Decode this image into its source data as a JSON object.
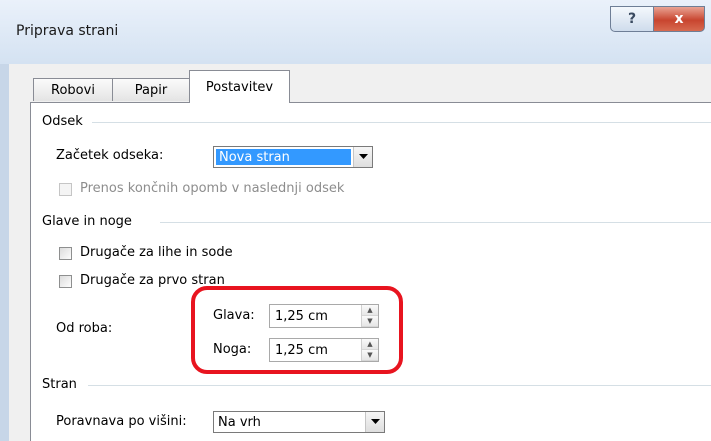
{
  "window": {
    "title": "Priprava strani",
    "help_symbol": "?",
    "close_symbol": "x"
  },
  "tabs": [
    {
      "label": "Robovi",
      "active": false
    },
    {
      "label": "Papir",
      "active": false
    },
    {
      "label": "Postavitev",
      "active": true
    }
  ],
  "section": {
    "heading": "Odsek",
    "start_label": "Začetek odseka:",
    "start_value": "Nova stran",
    "endnotes_label": "Prenos končnih opomb v naslednji odsek",
    "endnotes_checked": false
  },
  "headers_footers": {
    "heading": "Glave in noge",
    "odd_even_label": "Drugače za lihe in sode",
    "odd_even_checked": false,
    "first_page_label": "Drugače za prvo stran",
    "first_page_checked": false,
    "from_edge_label": "Od roba:",
    "header_label": "Glava:",
    "header_value": "1,25 cm",
    "footer_label": "Noga:",
    "footer_value": "1,25 cm"
  },
  "page": {
    "heading": "Stran",
    "vertical_align_label": "Poravnava po višini:",
    "vertical_align_value": "Na vrh"
  },
  "colors": {
    "highlight": "#e8141f",
    "selection": "#3399ff",
    "close_button": "#c8452f"
  },
  "icons": {
    "help": "help-icon",
    "close": "close-icon",
    "dropdown": "chevron-down-icon",
    "spin_up": "arrow-up-icon",
    "spin_down": "arrow-down-icon"
  }
}
